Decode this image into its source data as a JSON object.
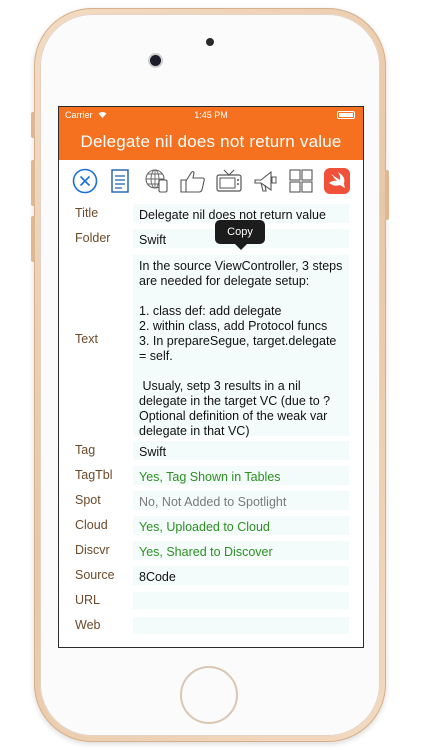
{
  "statusbar": {
    "carrier": "Carrier",
    "time": "1:45 PM"
  },
  "header": {
    "title": "Delegate nil does not return value"
  },
  "toolbar": {
    "icons": [
      "close-circle-icon",
      "document-icon",
      "globe-phone-icon",
      "thumbs-up-icon",
      "tv-icon",
      "megaphone-icon",
      "grid-icon",
      "swift-icon"
    ]
  },
  "tooltip": {
    "label": "Copy"
  },
  "fields": [
    {
      "label": "Title",
      "value": "Delegate nil does not return value"
    },
    {
      "label": "Folder",
      "value": "Swift"
    },
    {
      "label": "Text",
      "value": "In the source ViewController, 3 steps are needed for delegate setup:\n\n1. class def: add delegate\n2. within class, add Protocol funcs\n3. In prepareSegue, target.delegate = self.\n\n Usualy, setp 3 results in a nil delegate in the target VC (due to ? Optional definition of the weak var delegate in that VC)"
    },
    {
      "label": "Tag",
      "value": "Swift"
    },
    {
      "label": "TagTbl",
      "value": "Yes, Tag Shown in Tables"
    },
    {
      "label": "Spot",
      "value": "No, Not Added to Spotlight"
    },
    {
      "label": "Cloud",
      "value": "Yes, Uploaded to Cloud"
    },
    {
      "label": "Discvr",
      "value": "Yes, Shared to Discover"
    },
    {
      "label": "Source",
      "value": "8Code"
    },
    {
      "label": "URL",
      "value": ""
    },
    {
      "label": "Web",
      "value": ""
    }
  ],
  "colors": {
    "accent": "#f5711f",
    "label": "#6b4a2a",
    "green": "#2e8f22",
    "field_bg": "#f3fbfb"
  }
}
